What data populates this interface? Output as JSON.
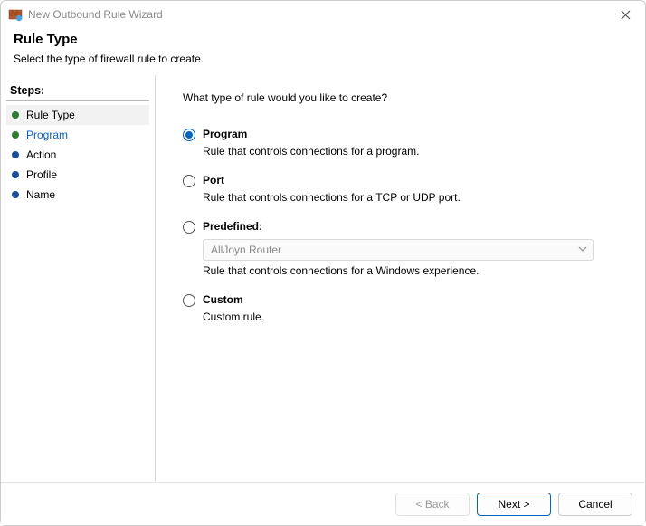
{
  "window": {
    "title": "New Outbound Rule Wizard"
  },
  "header": {
    "title": "Rule Type",
    "subtitle": "Select the type of firewall rule to create."
  },
  "sidebar": {
    "title": "Steps:",
    "items": [
      {
        "label": "Rule Type",
        "state": "current"
      },
      {
        "label": "Program",
        "state": "link"
      },
      {
        "label": "Action",
        "state": "pending"
      },
      {
        "label": "Profile",
        "state": "pending"
      },
      {
        "label": "Name",
        "state": "pending"
      }
    ]
  },
  "main": {
    "question": "What type of rule would you like to create?",
    "options": {
      "program": {
        "label": "Program",
        "desc": "Rule that controls connections for a program."
      },
      "port": {
        "label": "Port",
        "desc": "Rule that controls connections for a TCP or UDP port."
      },
      "predefined": {
        "label": "Predefined:",
        "dropdown_selected": "AllJoyn Router",
        "desc": "Rule that controls connections for a Windows experience."
      },
      "custom": {
        "label": "Custom",
        "desc": "Custom rule."
      }
    },
    "selected": "program"
  },
  "footer": {
    "back": "< Back",
    "next": "Next >",
    "cancel": "Cancel"
  }
}
